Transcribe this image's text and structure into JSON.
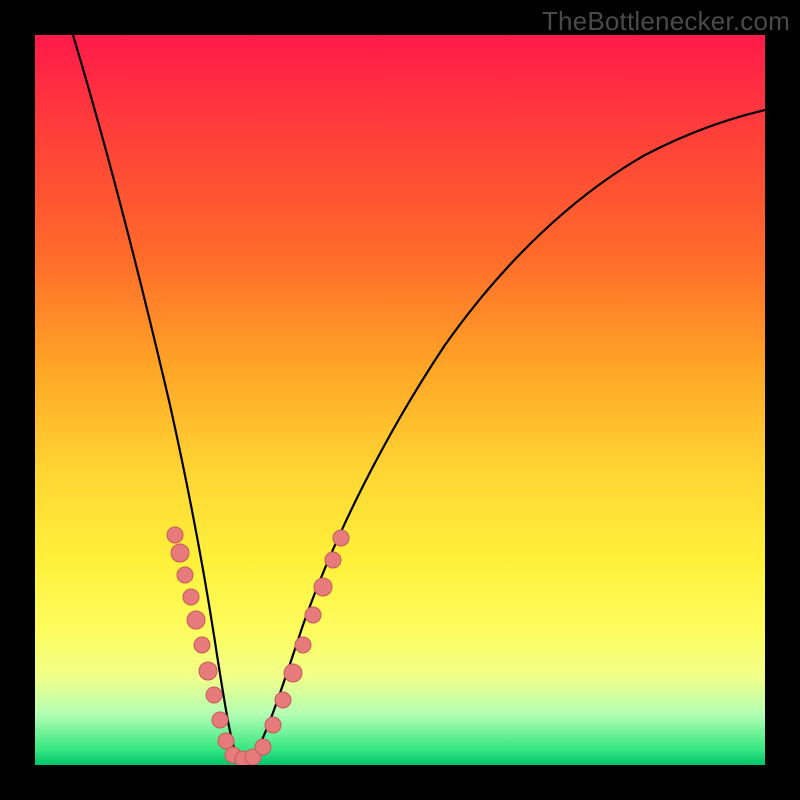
{
  "watermark": "TheBottlenecker.com",
  "colors": {
    "gradient_top": "#ff1a4a",
    "gradient_bottom": "#00c46a",
    "curve": "#000000",
    "dot_fill": "#e77b7b",
    "dot_stroke": "#c85a5a",
    "frame": "#000000"
  },
  "chart_data": {
    "type": "line",
    "title": "",
    "xlabel": "",
    "ylabel": "",
    "xlim": [
      0,
      100
    ],
    "ylim": [
      0,
      100
    ],
    "grid": false,
    "legend": false,
    "description": "V-shaped bottleneck curve. Y-axis encodes bottleneck severity (0 = green/good at bottom, 100 = red/bad at top). X-axis is an unlabeled parameter swept left→right. Curve reaches ~0 (optimal) around x≈27.",
    "series": [
      {
        "name": "bottleneck_curve",
        "x": [
          0,
          4,
          8,
          12,
          16,
          18,
          20,
          22,
          24,
          26,
          27,
          28,
          30,
          33,
          37,
          42,
          48,
          55,
          63,
          72,
          82,
          92,
          100
        ],
        "y": [
          100,
          86,
          72,
          58,
          42,
          34,
          27,
          19,
          11,
          4,
          1,
          3,
          8,
          16,
          26,
          38,
          50,
          60,
          69,
          76,
          82,
          86,
          88
        ]
      }
    ],
    "annotations": {
      "dot_clusters": [
        {
          "side": "left",
          "x_range": [
            17,
            25
          ],
          "y_range": [
            7,
            35
          ],
          "count": 10
        },
        {
          "side": "right",
          "x_range": [
            30,
            37
          ],
          "y_range": [
            7,
            35
          ],
          "count": 8
        },
        {
          "side": "bottom",
          "x_range": [
            24,
            30
          ],
          "y_range": [
            0,
            4
          ],
          "count": 5
        }
      ]
    }
  }
}
